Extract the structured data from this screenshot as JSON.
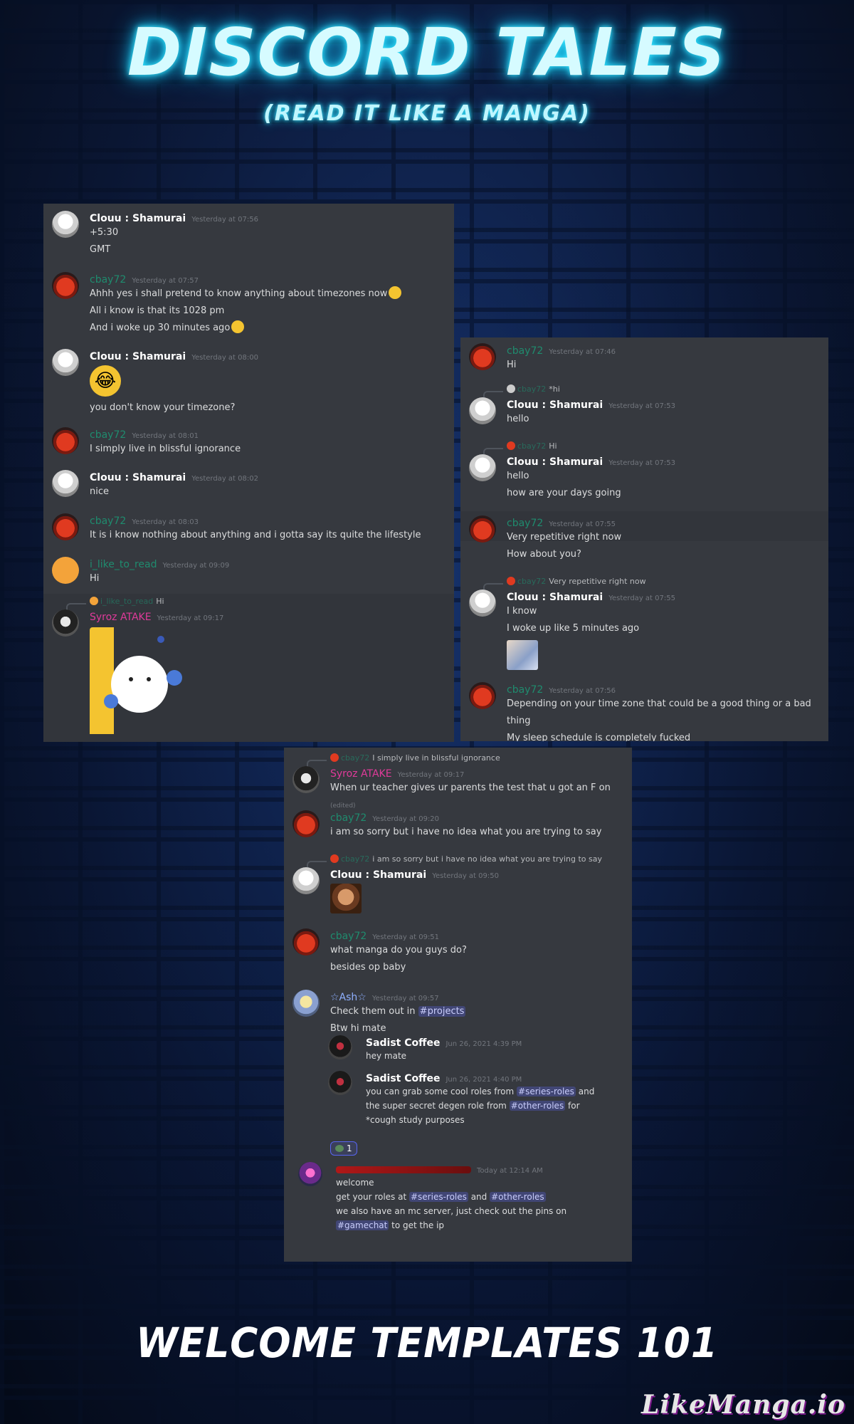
{
  "header": {
    "title": "DISCORD TALES",
    "subtitle": "(READ IT LIKE A MANGA)"
  },
  "footer": {
    "title": "WELCOME TEMPLATES 101",
    "watermark": "LikeManga.io"
  },
  "panel1": {
    "messages": [
      {
        "author": "Clouu : Shamurai",
        "time": "Yesterday at 07:56",
        "lines": [
          "+5:30",
          "GMT"
        ]
      },
      {
        "author": "cbay72",
        "time": "Yesterday at 07:57",
        "lines": [
          "Ahhh yes i shall pretend to know anything about timezones now",
          "All i know is that its 1028 pm",
          "And i woke up 30 minutes ago"
        ]
      },
      {
        "author": "Clouu : Shamurai",
        "time": "Yesterday at 08:00",
        "emoji": "😂",
        "lines": [
          "you don't know your timezone?"
        ]
      },
      {
        "author": "cbay72",
        "time": "Yesterday at 08:01",
        "lines": [
          "I simply live in blissful ignorance"
        ]
      },
      {
        "author": "Clouu : Shamurai",
        "time": "Yesterday at 08:02",
        "lines": [
          "nice"
        ]
      },
      {
        "author": "cbay72",
        "time": "Yesterday at 08:03",
        "lines": [
          "It is i know nothing about anything and i gotta say its quite the lifestyle"
        ]
      },
      {
        "author": "i_like_to_read",
        "time": "Yesterday at 09:09",
        "lines": [
          "Hi"
        ]
      },
      {
        "reply_name": "i_like_to_read",
        "reply_text": "Hi",
        "author": "Syroz ATAKE",
        "time": "Yesterday at 09:17"
      }
    ]
  },
  "panel2": {
    "messages": [
      {
        "author": "cbay72",
        "time": "Yesterday at 07:46",
        "lines": [
          "Hi"
        ]
      },
      {
        "reply_name": "cbay72",
        "reply_text": "*hi",
        "author": "Clouu : Shamurai",
        "time": "Yesterday at 07:53",
        "lines": [
          "hello"
        ]
      },
      {
        "reply_name": "cbay72",
        "reply_text": "Hi",
        "author": "Clouu : Shamurai",
        "time": "Yesterday at 07:53",
        "lines": [
          "hello",
          "how are your days going"
        ]
      },
      {
        "author": "cbay72",
        "time": "Yesterday at 07:55",
        "lines": [
          "Very repetitive right now",
          "How about you?"
        ]
      },
      {
        "reply_name": "cbay72",
        "reply_text": "Very repetitive right now",
        "author": "Clouu : Shamurai",
        "time": "Yesterday at 07:55",
        "lines": [
          "I know",
          "I woke up like 5 minutes ago"
        ]
      },
      {
        "author": "cbay72",
        "time": "Yesterday at 07:56",
        "lines": [
          "Depending on your time zone that could be a good thing or a bad thing",
          "My sleep schedule is completely fucked"
        ]
      }
    ]
  },
  "panel3": {
    "messages": [
      {
        "reply_name": "cbay72",
        "reply_text": "I simply live in blissful ignorance",
        "author": "Syroz ATAKE",
        "time": "Yesterday at 09:17",
        "lines": [
          "When ur teacher gives ur parents the test that u got an F on"
        ],
        "edited": "(edited)"
      },
      {
        "author": "cbay72",
        "time": "Yesterday at 09:20",
        "lines": [
          "i am so sorry but i have no idea what you are trying to say"
        ]
      },
      {
        "reply_name": "cbay72",
        "reply_text": "i am so sorry but i have no idea what you are trying to say",
        "author": "Clouu : Shamurai",
        "time": "Yesterday at 09:50"
      },
      {
        "author": "cbay72",
        "time": "Yesterday at 09:51",
        "lines": [
          "what manga do you guys do?",
          "besides op baby"
        ]
      },
      {
        "author": "☆Ash☆",
        "time": "Yesterday at 09:57",
        "line1_pre": "Check them out in ",
        "line1_mention": "#projects",
        "line2": "Btw hi mate"
      }
    ],
    "embedded": [
      {
        "author": "Sadist Coffee",
        "time": "Jun 26, 2021 4:39 PM",
        "lines": [
          "hey mate"
        ]
      },
      {
        "author": "Sadist Coffee",
        "time": "Jun 26, 2021 4:40 PM",
        "l1_pre": "you can grab some cool roles from ",
        "l1_m": "#series-roles",
        "l1_post": " and",
        "l2_pre": "the super secret degen role from ",
        "l2_m": "#other-roles",
        "l2_post": " for",
        "l3": "*cough study purposes"
      }
    ],
    "reaction_count": "1",
    "welcome": {
      "time": "Today at 12:14 AM",
      "l1": "welcome",
      "l2_pre": "get your roles at ",
      "l2_m1": "#series-roles",
      "l2_mid": "  and ",
      "l2_m2": "#other-roles",
      "l3": "we also have an mc server, just check out the pins on",
      "l4_m": "#gamechat",
      "l4_post": " to get the ip"
    }
  },
  "colors": {
    "accent_teal": "#1f8b6e",
    "mention_bg": "#414675",
    "panel_bg": "#36393f"
  }
}
